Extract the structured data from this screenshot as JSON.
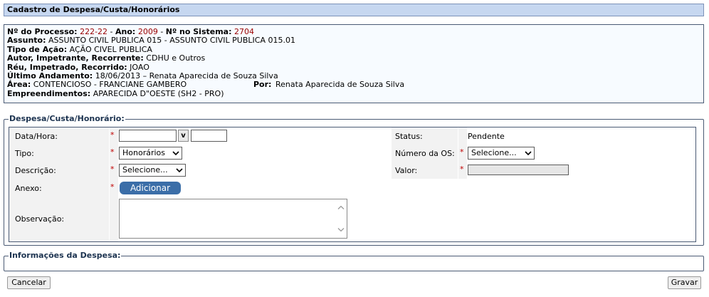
{
  "title": "Cadastro de Despesa/Custa/Honorários",
  "processo": {
    "num_label": "Nº do Processo:",
    "num_value": "222-22",
    "ano_label": "Ano:",
    "ano_value": "2009",
    "sistema_label": "Nº no Sistema:",
    "sistema_value": "2704",
    "assunto_label": "Assunto:",
    "assunto_value": "ASSUNTO CIVIL PUBLICA 015 - ASSUNTO CIVIL PUBLICA 015.01",
    "tipo_acao_label": "Tipo de Ação:",
    "tipo_acao_value": "AÇÃO CIVEL PUBLICA",
    "autor_label": "Autor, Impetrante, Recorrente:",
    "autor_value": "CDHU e Outros",
    "reu_label": "Réu, Impetrado, Recorrido:",
    "reu_value": "JOAO",
    "andamento_label": "Último Andamento:",
    "andamento_value": "18/06/2013 – Renata Aparecida de Souza Silva",
    "area_label": "Área:",
    "area_value": "CONTENCIOSO - FRANCIANE GAMBERO",
    "por_label": "Por:",
    "por_value": "Renata Aparecida de Souza Silva",
    "empreendimentos_label": "Empreendimentos:",
    "empreendimentos_value": "APARECIDA D\"OESTE (SH2 - PRO)"
  },
  "form": {
    "legend": "Despesa/Custa/Honorário:",
    "required_mark": "*",
    "data_hora_label": "Data/Hora:",
    "data_value": "",
    "hora_value": "",
    "calendar_btn": "v",
    "tipo_label": "Tipo:",
    "tipo_value": "Honorários",
    "descricao_label": "Descrição:",
    "descricao_value": "Selecione...",
    "anexo_label": "Anexo:",
    "adicionar_btn": "Adicionar",
    "observacao_label": "Observação:",
    "observacao_value": "",
    "status_label": "Status:",
    "status_value": "Pendente",
    "os_label": "Número da OS:",
    "os_value": "Selecione...",
    "valor_label": "Valor:"
  },
  "info_despesa": {
    "legend": "Informações da Despesa:"
  },
  "buttons": {
    "cancelar": "Cancelar",
    "gravar": "Gravar"
  }
}
